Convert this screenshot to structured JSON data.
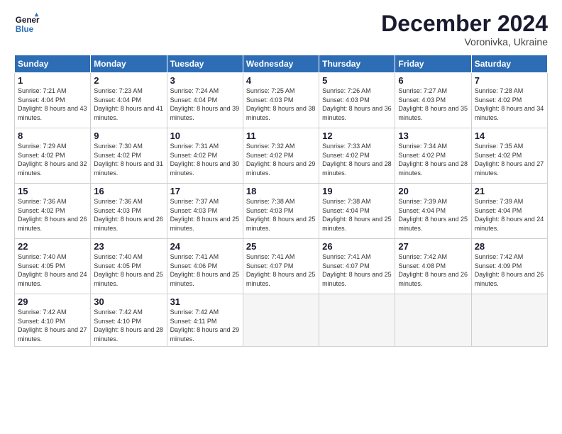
{
  "header": {
    "logo_line1": "General",
    "logo_line2": "Blue",
    "month": "December 2024",
    "location": "Voronivka, Ukraine"
  },
  "weekdays": [
    "Sunday",
    "Monday",
    "Tuesday",
    "Wednesday",
    "Thursday",
    "Friday",
    "Saturday"
  ],
  "weeks": [
    [
      {
        "day": "1",
        "sunrise": "7:21 AM",
        "sunset": "4:04 PM",
        "daylight": "8 hours and 43 minutes."
      },
      {
        "day": "2",
        "sunrise": "7:23 AM",
        "sunset": "4:04 PM",
        "daylight": "8 hours and 41 minutes."
      },
      {
        "day": "3",
        "sunrise": "7:24 AM",
        "sunset": "4:04 PM",
        "daylight": "8 hours and 39 minutes."
      },
      {
        "day": "4",
        "sunrise": "7:25 AM",
        "sunset": "4:03 PM",
        "daylight": "8 hours and 38 minutes."
      },
      {
        "day": "5",
        "sunrise": "7:26 AM",
        "sunset": "4:03 PM",
        "daylight": "8 hours and 36 minutes."
      },
      {
        "day": "6",
        "sunrise": "7:27 AM",
        "sunset": "4:03 PM",
        "daylight": "8 hours and 35 minutes."
      },
      {
        "day": "7",
        "sunrise": "7:28 AM",
        "sunset": "4:02 PM",
        "daylight": "8 hours and 34 minutes."
      }
    ],
    [
      {
        "day": "8",
        "sunrise": "7:29 AM",
        "sunset": "4:02 PM",
        "daylight": "8 hours and 32 minutes."
      },
      {
        "day": "9",
        "sunrise": "7:30 AM",
        "sunset": "4:02 PM",
        "daylight": "8 hours and 31 minutes."
      },
      {
        "day": "10",
        "sunrise": "7:31 AM",
        "sunset": "4:02 PM",
        "daylight": "8 hours and 30 minutes."
      },
      {
        "day": "11",
        "sunrise": "7:32 AM",
        "sunset": "4:02 PM",
        "daylight": "8 hours and 29 minutes."
      },
      {
        "day": "12",
        "sunrise": "7:33 AM",
        "sunset": "4:02 PM",
        "daylight": "8 hours and 28 minutes."
      },
      {
        "day": "13",
        "sunrise": "7:34 AM",
        "sunset": "4:02 PM",
        "daylight": "8 hours and 28 minutes."
      },
      {
        "day": "14",
        "sunrise": "7:35 AM",
        "sunset": "4:02 PM",
        "daylight": "8 hours and 27 minutes."
      }
    ],
    [
      {
        "day": "15",
        "sunrise": "7:36 AM",
        "sunset": "4:02 PM",
        "daylight": "8 hours and 26 minutes."
      },
      {
        "day": "16",
        "sunrise": "7:36 AM",
        "sunset": "4:03 PM",
        "daylight": "8 hours and 26 minutes."
      },
      {
        "day": "17",
        "sunrise": "7:37 AM",
        "sunset": "4:03 PM",
        "daylight": "8 hours and 25 minutes."
      },
      {
        "day": "18",
        "sunrise": "7:38 AM",
        "sunset": "4:03 PM",
        "daylight": "8 hours and 25 minutes."
      },
      {
        "day": "19",
        "sunrise": "7:38 AM",
        "sunset": "4:04 PM",
        "daylight": "8 hours and 25 minutes."
      },
      {
        "day": "20",
        "sunrise": "7:39 AM",
        "sunset": "4:04 PM",
        "daylight": "8 hours and 25 minutes."
      },
      {
        "day": "21",
        "sunrise": "7:39 AM",
        "sunset": "4:04 PM",
        "daylight": "8 hours and 24 minutes."
      }
    ],
    [
      {
        "day": "22",
        "sunrise": "7:40 AM",
        "sunset": "4:05 PM",
        "daylight": "8 hours and 24 minutes."
      },
      {
        "day": "23",
        "sunrise": "7:40 AM",
        "sunset": "4:05 PM",
        "daylight": "8 hours and 25 minutes."
      },
      {
        "day": "24",
        "sunrise": "7:41 AM",
        "sunset": "4:06 PM",
        "daylight": "8 hours and 25 minutes."
      },
      {
        "day": "25",
        "sunrise": "7:41 AM",
        "sunset": "4:07 PM",
        "daylight": "8 hours and 25 minutes."
      },
      {
        "day": "26",
        "sunrise": "7:41 AM",
        "sunset": "4:07 PM",
        "daylight": "8 hours and 25 minutes."
      },
      {
        "day": "27",
        "sunrise": "7:42 AM",
        "sunset": "4:08 PM",
        "daylight": "8 hours and 26 minutes."
      },
      {
        "day": "28",
        "sunrise": "7:42 AM",
        "sunset": "4:09 PM",
        "daylight": "8 hours and 26 minutes."
      }
    ],
    [
      {
        "day": "29",
        "sunrise": "7:42 AM",
        "sunset": "4:10 PM",
        "daylight": "8 hours and 27 minutes."
      },
      {
        "day": "30",
        "sunrise": "7:42 AM",
        "sunset": "4:10 PM",
        "daylight": "8 hours and 28 minutes."
      },
      {
        "day": "31",
        "sunrise": "7:42 AM",
        "sunset": "4:11 PM",
        "daylight": "8 hours and 29 minutes."
      },
      null,
      null,
      null,
      null
    ]
  ]
}
